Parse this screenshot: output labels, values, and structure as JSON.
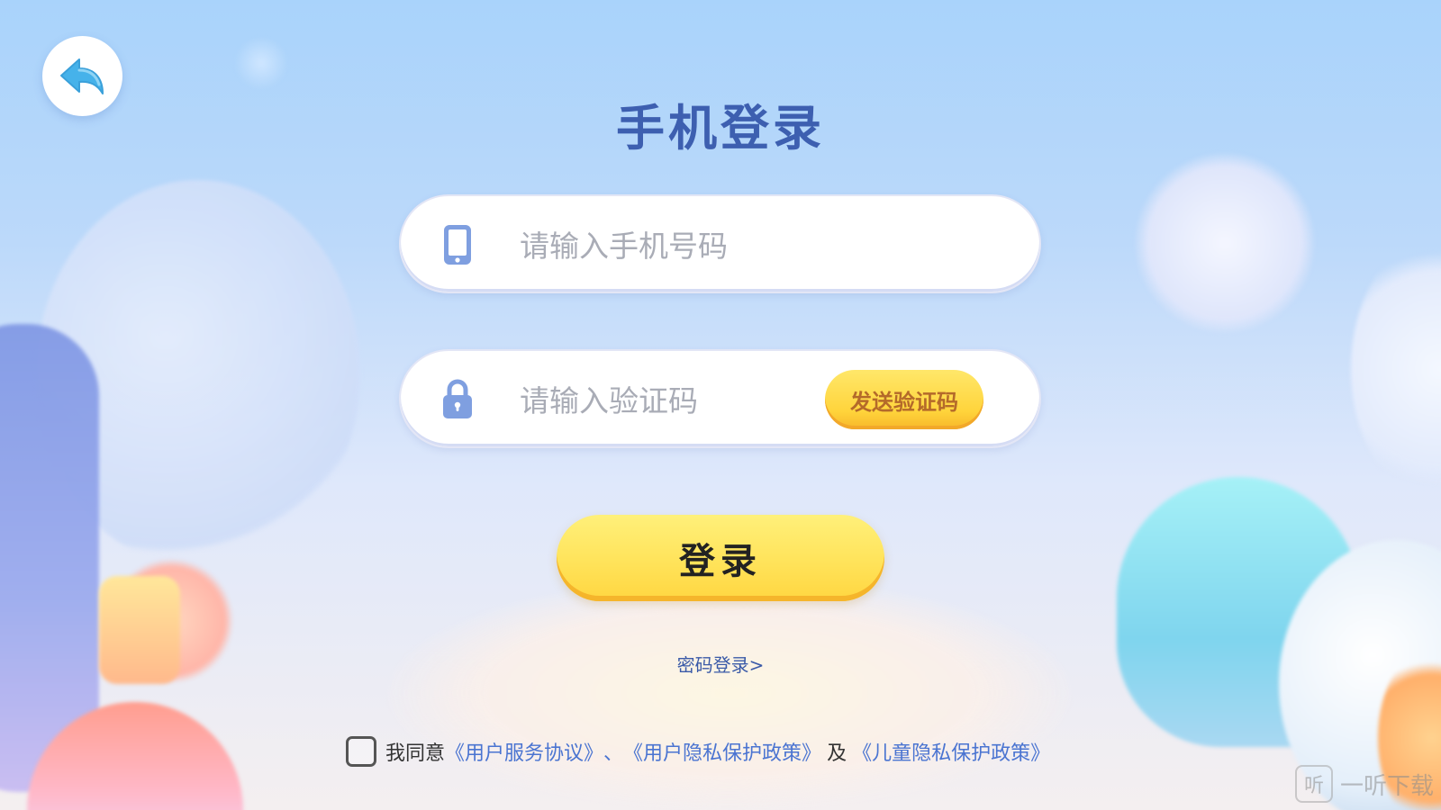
{
  "header": {
    "title": "手机登录",
    "back_icon": "back-arrow-icon"
  },
  "phone_field": {
    "icon": "phone-icon",
    "placeholder": "请输入手机号码",
    "value": ""
  },
  "code_field": {
    "icon": "lock-icon",
    "placeholder": "请输入验证码",
    "value": "",
    "send_code_label": "发送验证码"
  },
  "login_button_label": "登录",
  "password_login_link": "密码登录>",
  "agreement": {
    "checked": false,
    "prefix": "我同意",
    "user_service": "《用户服务协议》",
    "separator": "、",
    "user_privacy": "《用户隐私保护政策》",
    "conjunction": "及",
    "child_privacy": "《儿童隐私保护政策》"
  },
  "watermark": {
    "icon_glyph": "听",
    "text": "一听下载"
  },
  "colors": {
    "title": "#3d5fb0",
    "link": "#4a74d1",
    "button_yellow": "#ffe35a",
    "icon_blue": "#7f9fe0"
  }
}
